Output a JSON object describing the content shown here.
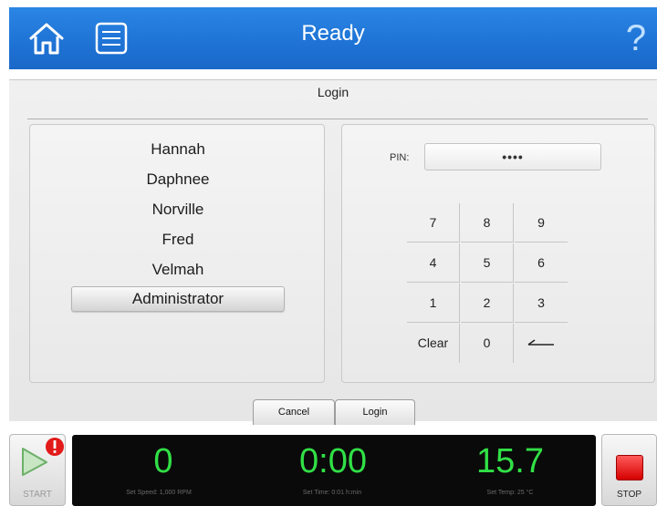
{
  "header": {
    "title": "Ready",
    "help_glyph": "?",
    "accent_color": "#1f74d6"
  },
  "login": {
    "title": "Login",
    "users": [
      "Hannah",
      "Daphnee",
      "Norville",
      "Fred",
      "Velmah",
      "Administrator"
    ],
    "selected_user": "Administrator",
    "pin_label": "PIN:",
    "pin_value": "••••",
    "keypad": [
      "7",
      "8",
      "9",
      "4",
      "5",
      "6",
      "1",
      "2",
      "3",
      "Clear",
      "0",
      "backspace"
    ],
    "cancel_label": "Cancel",
    "login_label": "Login"
  },
  "status": {
    "start_label": "START",
    "stop_label": "STOP",
    "speed_value": "0",
    "speed_set": "Set Speed: 1,000 RPM",
    "time_value": "0:00",
    "time_set": "Set Time: 0:01 h:min",
    "temp_value": "15.7",
    "temp_set": "Set Temp: 25 °C",
    "readout_color": "#31e046",
    "stop_color": "#e00000"
  }
}
